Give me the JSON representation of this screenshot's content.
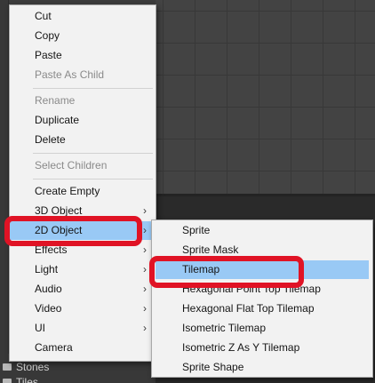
{
  "main_menu": {
    "items": [
      {
        "label": "Cut",
        "disabled": false
      },
      {
        "label": "Copy",
        "disabled": false
      },
      {
        "label": "Paste",
        "disabled": false
      },
      {
        "label": "Paste As Child",
        "disabled": true
      },
      {
        "label": "Rename",
        "disabled": true
      },
      {
        "label": "Duplicate",
        "disabled": false
      },
      {
        "label": "Delete",
        "disabled": false
      },
      {
        "label": "Select Children",
        "disabled": true
      },
      {
        "label": "Create Empty",
        "disabled": false
      },
      {
        "label": "3D Object",
        "disabled": false,
        "submenu": true
      },
      {
        "label": "2D Object",
        "disabled": false,
        "submenu": true
      },
      {
        "label": "Effects",
        "disabled": false,
        "submenu": true
      },
      {
        "label": "Light",
        "disabled": false,
        "submenu": true
      },
      {
        "label": "Audio",
        "disabled": false,
        "submenu": true
      },
      {
        "label": "Video",
        "disabled": false,
        "submenu": true
      },
      {
        "label": "UI",
        "disabled": false,
        "submenu": true
      },
      {
        "label": "Camera",
        "disabled": false
      }
    ],
    "submenu_arrow": "›"
  },
  "sub_menu": {
    "items": [
      {
        "label": "Sprite"
      },
      {
        "label": "Sprite Mask"
      },
      {
        "label": "Tilemap"
      },
      {
        "label": "Hexagonal Point Top Tilemap"
      },
      {
        "label": "Hexagonal Flat Top Tilemap"
      },
      {
        "label": "Isometric Tilemap"
      },
      {
        "label": "Isometric Z As Y Tilemap"
      },
      {
        "label": "Sprite Shape"
      }
    ]
  },
  "project": {
    "folders": [
      "Stones",
      "Tiles"
    ]
  },
  "colors": {
    "highlight": "#99c9f5",
    "annotation": "#e01325",
    "menu_bg": "#f2f2f2"
  }
}
